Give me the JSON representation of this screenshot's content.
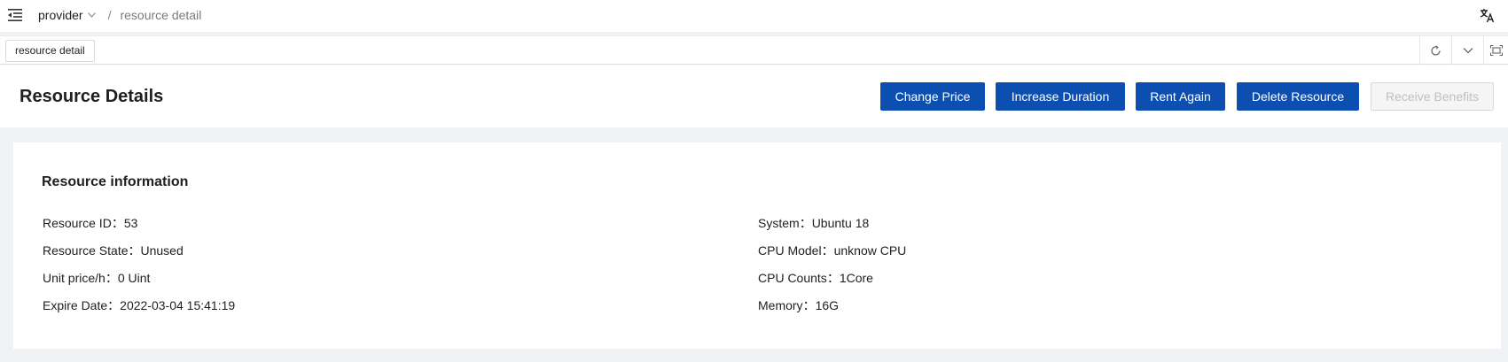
{
  "header": {
    "breadcrumb_parent": "provider",
    "breadcrumb_separator": "/",
    "breadcrumb_current": "resource detail"
  },
  "tabs": [
    {
      "label": "resource detail"
    }
  ],
  "page": {
    "title": "Resource Details",
    "actions": {
      "change_price": "Change Price",
      "increase_duration": "Increase Duration",
      "rent_again": "Rent Again",
      "delete_resource": "Delete Resource",
      "receive_benefits": "Receive Benefits"
    }
  },
  "resource": {
    "section_title": "Resource information",
    "left": [
      {
        "label": "Resource ID",
        "value": "53"
      },
      {
        "label": "Resource State",
        "value": "Unused"
      },
      {
        "label": "Unit price/h",
        "value": "0 Uint"
      },
      {
        "label": "Expire Date",
        "value": "2022-03-04 15:41:19"
      }
    ],
    "right": [
      {
        "label": "System",
        "value": "Ubuntu 18"
      },
      {
        "label": "CPU Model",
        "value": "unknow CPU"
      },
      {
        "label": "CPU Counts",
        "value": "1Core"
      },
      {
        "label": "Memory",
        "value": "16G"
      }
    ]
  },
  "colors": {
    "primary_button": "#0d4fb0",
    "page_background": "#f0f2f5"
  }
}
